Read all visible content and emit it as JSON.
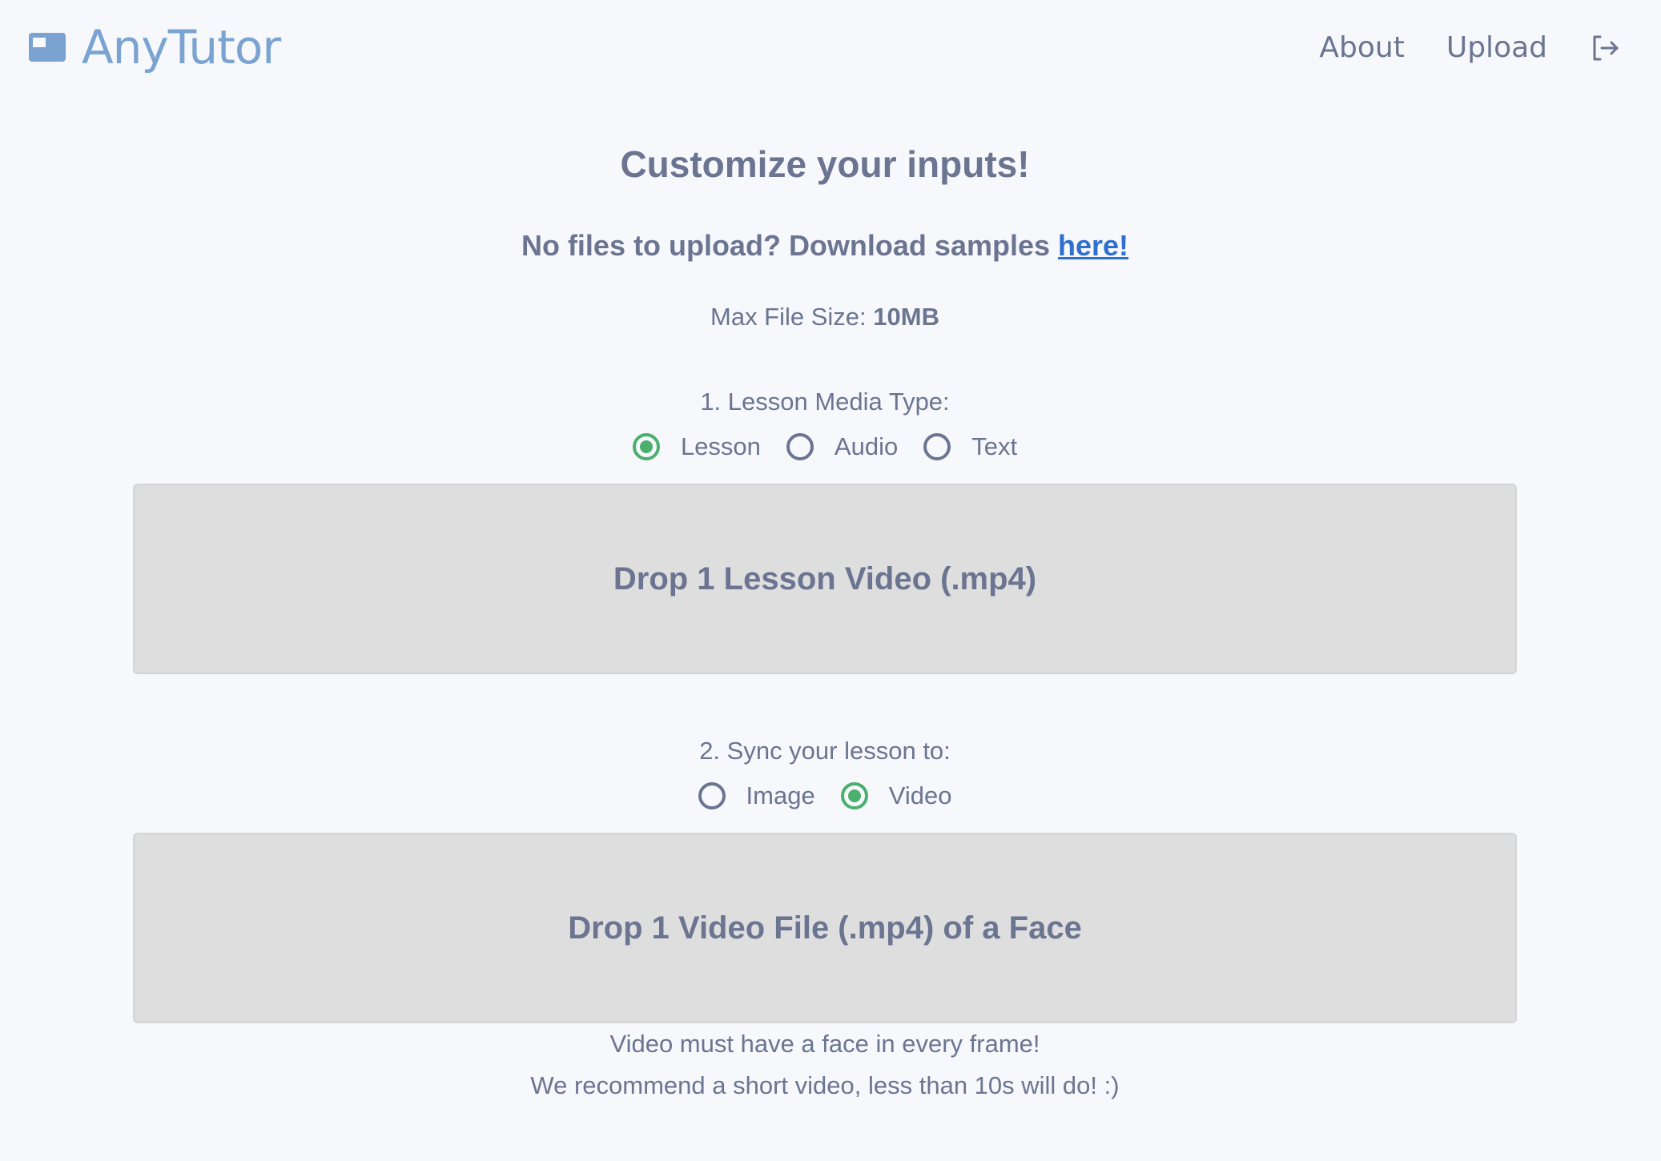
{
  "header": {
    "brand": "AnyTutor",
    "nav": {
      "about": "About",
      "upload": "Upload"
    }
  },
  "main": {
    "title": "Customize your inputs!",
    "samples_prefix": "No files to upload? Download samples ",
    "samples_link": "here!",
    "max_size_label": "Max File Size: ",
    "max_size_value": "10MB",
    "section1": {
      "label": "1. Lesson Media Type:",
      "options": [
        "Lesson",
        "Audio",
        "Text"
      ],
      "selected": "Lesson",
      "dropzone": "Drop 1 Lesson Video (.mp4)"
    },
    "section2": {
      "label": "2. Sync your lesson to:",
      "options": [
        "Image",
        "Video"
      ],
      "selected": "Video",
      "dropzone": "Drop 1 Video File (.mp4) of a Face"
    },
    "notes": [
      "Video must have a face in every frame!",
      "We recommend a short video, less than 10s will do! :)"
    ]
  },
  "colors": {
    "background": "#f6f8fc",
    "brand": "#7aa3d1",
    "text": "#6b7591",
    "link": "#2f6fce",
    "radio_checked": "#4caf6d",
    "dropzone": "#dedede"
  },
  "icons": {
    "brand": "window-icon",
    "logout": "logout-icon"
  }
}
